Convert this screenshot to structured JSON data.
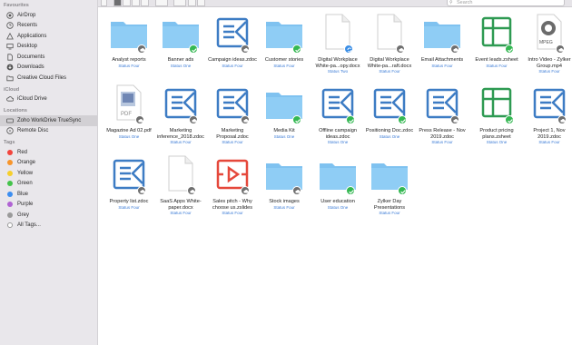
{
  "sidebar": {
    "favourites_header": "Favourites",
    "favourites": [
      {
        "label": "AirDrop",
        "icon": "airdrop-icon"
      },
      {
        "label": "Recents",
        "icon": "clock-icon"
      },
      {
        "label": "Applications",
        "icon": "applications-icon"
      },
      {
        "label": "Desktop",
        "icon": "desktop-icon"
      },
      {
        "label": "Documents",
        "icon": "document-icon"
      },
      {
        "label": "Downloads",
        "icon": "download-icon"
      },
      {
        "label": "Creative Cloud Files",
        "icon": "folder-icon"
      }
    ],
    "icloud_header": "iCloud",
    "icloud": [
      {
        "label": "iCloud Drive",
        "icon": "cloud-icon"
      }
    ],
    "locations_header": "Locations",
    "locations": [
      {
        "label": "Zoho WorkDrive TrueSync",
        "icon": "drive-icon"
      },
      {
        "label": "Remote Disc",
        "icon": "disc-icon"
      }
    ],
    "tags_header": "Tags",
    "tags": [
      {
        "label": "Red",
        "color": "#f2453d"
      },
      {
        "label": "Orange",
        "color": "#f7952b"
      },
      {
        "label": "Yellow",
        "color": "#f6cf2c"
      },
      {
        "label": "Green",
        "color": "#44c34b"
      },
      {
        "label": "Blue",
        "color": "#3c8ef0"
      },
      {
        "label": "Purple",
        "color": "#b063d3"
      },
      {
        "label": "Grey",
        "color": "#9a9a9a"
      },
      {
        "label": "All Tags...",
        "color": "#ffffff"
      }
    ]
  },
  "toolbar": {
    "search_placeholder": "Search"
  },
  "colors": {
    "folder": "#7fc2f0",
    "writer": "#3d7cc4",
    "sheet": "#2e9a52",
    "show": "#e5483b",
    "status": "#3b7bd6"
  },
  "files": [
    {
      "name": "Analyst reports",
      "status": "Status Four",
      "type": "folder",
      "badge": "cloud"
    },
    {
      "name": "Banner ads",
      "status": "Status One",
      "type": "folder",
      "badge": "check"
    },
    {
      "name": "Campaign ideas.zdoc",
      "status": "Status Four",
      "type": "writer",
      "badge": "cloud"
    },
    {
      "name": "Customer stories",
      "status": "Status Four",
      "type": "folder",
      "badge": "check"
    },
    {
      "name": "Digital Workplace White-pa...opy.docx",
      "status": "Status Two",
      "type": "doc",
      "badge": "sync"
    },
    {
      "name": "Digital Workplace White-pa...raft.docx",
      "status": "Status Four",
      "type": "doc",
      "badge": "cloud"
    },
    {
      "name": "Email Attachments",
      "status": "Status Four",
      "type": "folder",
      "badge": "cloud"
    },
    {
      "name": "Event leads.zsheet",
      "status": "Status Four",
      "type": "sheet",
      "badge": "check"
    },
    {
      "name": "Intro Video - Zylker Group.mp4",
      "status": "Status Four",
      "type": "video",
      "badge": "cloud"
    },
    {
      "name": "Magazine Ad 02.pdf",
      "status": "Status One",
      "type": "pdf",
      "badge": "cloud"
    },
    {
      "name": "Marketing inference_2018.zdoc",
      "status": "Status Four",
      "type": "writer",
      "badge": "cloud"
    },
    {
      "name": "Marketing Proposal.zdoc",
      "status": "Status Four",
      "type": "writer",
      "badge": "cloud"
    },
    {
      "name": "Media Kit",
      "status": "Status One",
      "type": "folder",
      "badge": "check"
    },
    {
      "name": "Offline campaign ideas.zdoc",
      "status": "Status One",
      "type": "writer",
      "badge": "check"
    },
    {
      "name": "Positioning Doc.zdoc",
      "status": "Status One",
      "type": "writer",
      "badge": "check"
    },
    {
      "name": "Press Release - Nov 2019.zdoc",
      "status": "Status Four",
      "type": "writer",
      "badge": "cloud"
    },
    {
      "name": "Product pricing plans.zsheet",
      "status": "Status One",
      "type": "sheet",
      "badge": "check"
    },
    {
      "name": "Project 1, Nov 2019.zdoc",
      "status": "Status Four",
      "type": "writer",
      "badge": "cloud"
    },
    {
      "name": "Property list.zdoc",
      "status": "Status Four",
      "type": "writer",
      "badge": "cloud"
    },
    {
      "name": "SaaS Apps White-paper.docx",
      "status": "Status Four",
      "type": "doc",
      "badge": "cloud"
    },
    {
      "name": "Sales pitch - Why choose us.zslides",
      "status": "Status Four",
      "type": "show",
      "badge": "cloud"
    },
    {
      "name": "Stock images",
      "status": "Status Four",
      "type": "folder",
      "badge": "cloud"
    },
    {
      "name": "User education",
      "status": "Status One",
      "type": "folder",
      "badge": "check"
    },
    {
      "name": "Zylker Day Presentations",
      "status": "Status Four",
      "type": "folder",
      "badge": "check"
    }
  ]
}
